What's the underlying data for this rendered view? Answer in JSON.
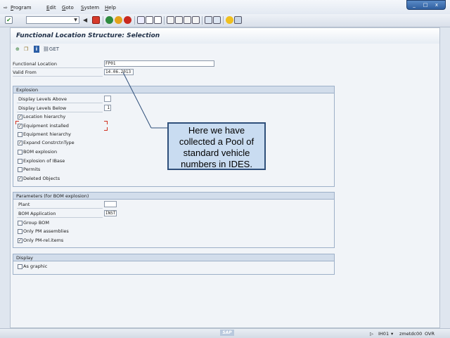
{
  "menubar": {
    "items": [
      "Program",
      "Edit",
      "Goto",
      "System",
      "Help"
    ],
    "underline": [
      "P",
      "E",
      "G",
      "S",
      "H"
    ],
    "rest": [
      "rogram",
      "dit",
      "oto",
      "ystem",
      "elp"
    ]
  },
  "window_controls": {
    "minimize": "_",
    "maximize": "□",
    "close": "x"
  },
  "page_title": "Functional Location Structure: Selection",
  "app_toolbar": {
    "get_label": "GET"
  },
  "fields": {
    "functional_location": {
      "label": "Functional Location",
      "value": "FP01"
    },
    "valid_from": {
      "label": "Valid From",
      "value": "14.06.2013"
    }
  },
  "explosion": {
    "title": "Explosion",
    "levels_above": {
      "label": "Display Levels Above",
      "value": ""
    },
    "levels_below": {
      "label": "Display Levels Below",
      "value": "1"
    },
    "checkboxes": [
      {
        "label": "Location hierarchy",
        "checked": true
      },
      {
        "label": "Equipment installed",
        "checked": true
      },
      {
        "label": "Equipment hierarchy",
        "checked": false
      },
      {
        "label": "Expand ConstrctnType",
        "checked": true
      },
      {
        "label": "BOM explosion",
        "checked": false
      },
      {
        "label": "Explosion of IBase",
        "checked": false
      },
      {
        "label": "Permits",
        "checked": false
      },
      {
        "label": "Deleted Objects",
        "checked": true
      }
    ]
  },
  "parameters": {
    "title": "Parameters (for BOM explosion)",
    "plant": {
      "label": "Plant",
      "value": ""
    },
    "bom_application": {
      "label": "BOM Application",
      "value": "INST"
    },
    "checkboxes": [
      {
        "label": "Group BOM",
        "checked": false
      },
      {
        "label": "Only PM assemblies",
        "checked": false
      },
      {
        "label": "Only PM-rel.items",
        "checked": true
      }
    ]
  },
  "display": {
    "title": "Display",
    "checkboxes": [
      {
        "label": "As graphic",
        "checked": false
      }
    ]
  },
  "callout": {
    "lines": [
      "Here we have",
      "collected a Pool of",
      "standard vehicle",
      "numbers in IDES."
    ]
  },
  "statusbar": {
    "transaction": "IH01",
    "server": "zmetdc00",
    "mode": "OVR",
    "logo": "SAP"
  },
  "colors": {
    "background": "#dfe6ef",
    "group_header": "#d2ddeb",
    "callout_fill": "#c9dcf1",
    "callout_border": "#2f4f7a"
  }
}
